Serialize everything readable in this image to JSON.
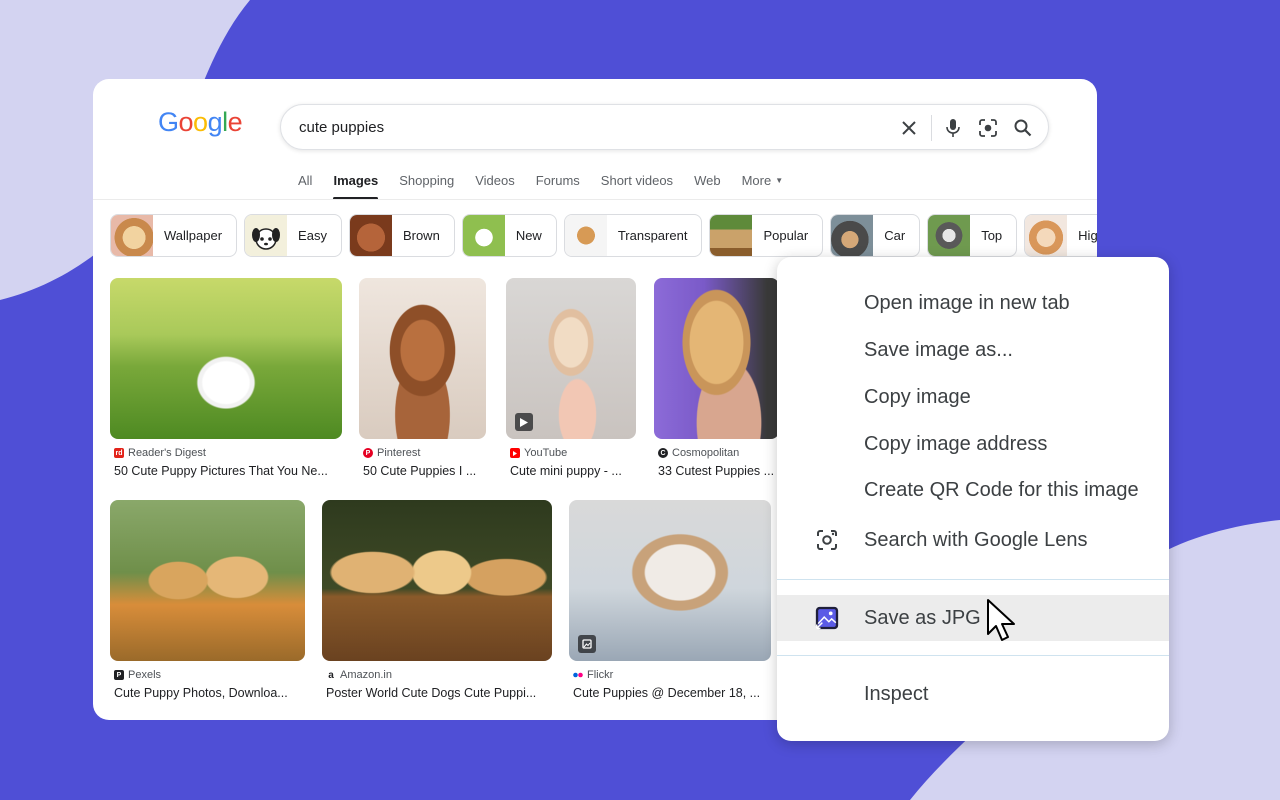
{
  "colors": {
    "background": "#4f4fd6",
    "blob": "#d3d3f1",
    "accent": "#4f4fd6"
  },
  "logo": {
    "letters": [
      "G",
      "o",
      "o",
      "g",
      "l",
      "e"
    ],
    "colors": [
      "#4285f4",
      "#ea4335",
      "#fbbc05",
      "#4285f4",
      "#34a853",
      "#ea4335"
    ]
  },
  "search": {
    "query": "cute puppies",
    "icons": [
      "clear-icon",
      "mic-icon",
      "lens-icon",
      "search-icon"
    ]
  },
  "tabs": [
    {
      "label": "All"
    },
    {
      "label": "Images",
      "active": true
    },
    {
      "label": "Shopping"
    },
    {
      "label": "Videos"
    },
    {
      "label": "Forums"
    },
    {
      "label": "Short videos"
    },
    {
      "label": "Web"
    },
    {
      "label": "More"
    }
  ],
  "chips": [
    {
      "label": "Wallpaper"
    },
    {
      "label": "Easy"
    },
    {
      "label": "Brown"
    },
    {
      "label": "New"
    },
    {
      "label": "Transparent"
    },
    {
      "label": "Popular"
    },
    {
      "label": "Car"
    },
    {
      "label": "Top"
    },
    {
      "label": "High r"
    }
  ],
  "results": [
    {
      "source": "Reader's Digest",
      "title": "50 Cute Puppy Pictures That You Ne...",
      "fav_color": "#e2231a"
    },
    {
      "source": "Pinterest",
      "title": "50 Cute Puppies I ...",
      "fav_color": "#e60023"
    },
    {
      "source": "YouTube",
      "title": "Cute mini puppy - ...",
      "fav_color": "#ff0000"
    },
    {
      "source": "Cosmopolitan",
      "title": "33 Cutest Puppies ...",
      "fav_color": "#202124"
    },
    {
      "source": "Pexels",
      "title": "Cute Puppy Photos, Downloa...",
      "fav_color": "#202124"
    },
    {
      "source": "Amazon.in",
      "title": "Poster World Cute Dogs Cute Puppi...",
      "fav_color": "#ff9900"
    },
    {
      "source": "Flickr",
      "title": "Cute Puppies @ December 18, ...",
      "fav_color": "#0063dc"
    }
  ],
  "context_menu": {
    "items": [
      {
        "label": "Open image in new tab"
      },
      {
        "label": "Save image as..."
      },
      {
        "label": "Copy image"
      },
      {
        "label": "Copy image address"
      },
      {
        "label": "Create QR Code for this image"
      },
      {
        "label": "Search with Google Lens",
        "icon": "lens-icon"
      },
      {
        "label": "Save as JPG",
        "icon": "save-image-icon",
        "highlighted": true
      },
      {
        "label": "Inspect"
      }
    ]
  }
}
